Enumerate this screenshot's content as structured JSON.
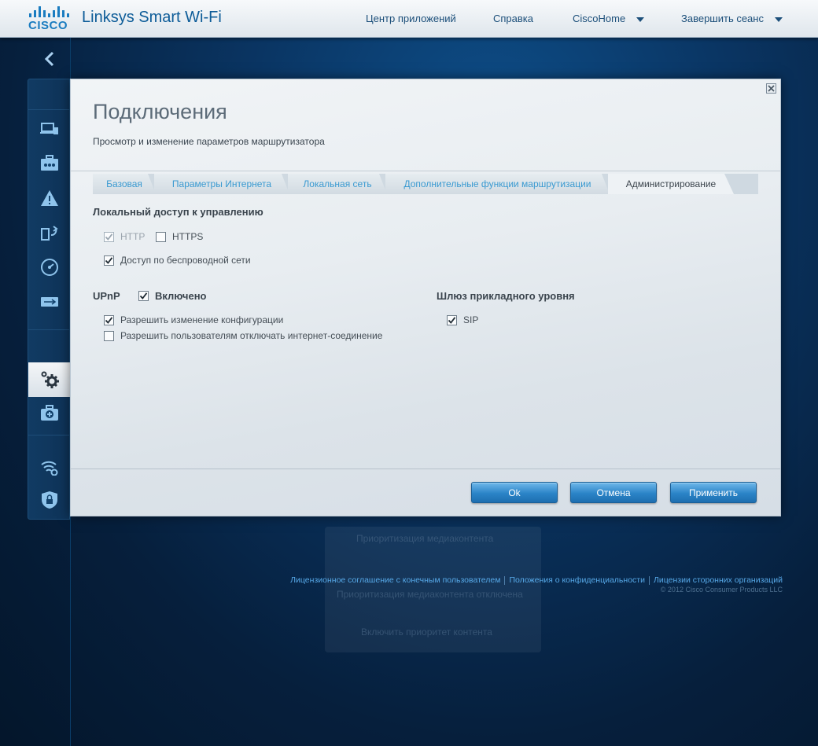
{
  "header": {
    "logo_text": "CISCO",
    "brand": "Linksys Smart Wi-Fi",
    "nav": {
      "app_center": "Центр приложений",
      "help": "Справка",
      "account": "CiscoHome",
      "logout": "Завершить сеанс"
    }
  },
  "sidebar": {
    "items": [
      {
        "icon": "devices-icon"
      },
      {
        "icon": "media-briefcase-icon"
      },
      {
        "icon": "network-warning-icon"
      },
      {
        "icon": "update-icon"
      },
      {
        "icon": "speedometer-icon"
      },
      {
        "icon": "usb-storage-icon"
      },
      {
        "icon": "settings-gears-icon",
        "active": true
      },
      {
        "icon": "troubleshooting-icon"
      },
      {
        "icon": "wireless-settings-icon"
      },
      {
        "icon": "security-shield-icon"
      }
    ]
  },
  "modal": {
    "title": "Подключения",
    "subtitle": "Просмотр и изменение параметров маршрутизатора",
    "tabs": [
      {
        "label": "Базовая"
      },
      {
        "label": "Параметры Интернета"
      },
      {
        "label": "Локальная сеть"
      },
      {
        "label": "Дополнительные функции маршрутизации"
      },
      {
        "label": "Администрирование",
        "active": true
      }
    ],
    "local_access": {
      "title": "Локальный доступ к управлению",
      "http": {
        "label": "HTTP",
        "checked": true,
        "disabled": true
      },
      "https": {
        "label": "HTTPS",
        "checked": false
      },
      "wireless": {
        "label": "Доступ по беспроводной сети",
        "checked": true
      }
    },
    "upnp": {
      "title": "UPnP",
      "enabled": {
        "label": "Включено",
        "checked": true
      },
      "allow_config": {
        "label": "Разрешить изменение конфигурации",
        "checked": true
      },
      "allow_disconnect": {
        "label": "Разрешить пользователям отключать интернет-соединение",
        "checked": false
      }
    },
    "alg": {
      "title": "Шлюз прикладного уровня",
      "sip": {
        "label": "SIP",
        "checked": true
      }
    },
    "buttons": {
      "ok": "Ok",
      "cancel": "Отмена",
      "apply": "Применить"
    }
  },
  "background": {
    "ghost_widget_title": "Приоритизация медиаконтента",
    "ghost_widget_text": "Приоритизация медиаконтента отключена",
    "ghost_widget_link": "Включить приоритет контента"
  },
  "footer": {
    "eula": "Лицензионное соглашение с конечным пользователем",
    "privacy": "Положения о конфиденциальности",
    "third_party": "Лицензии сторонних организаций",
    "copyright": "© 2012 Cisco Consumer Products LLC"
  },
  "colors": {
    "accent": "#2b84c7",
    "link": "#3a9ad1",
    "background": "#0a3563"
  }
}
